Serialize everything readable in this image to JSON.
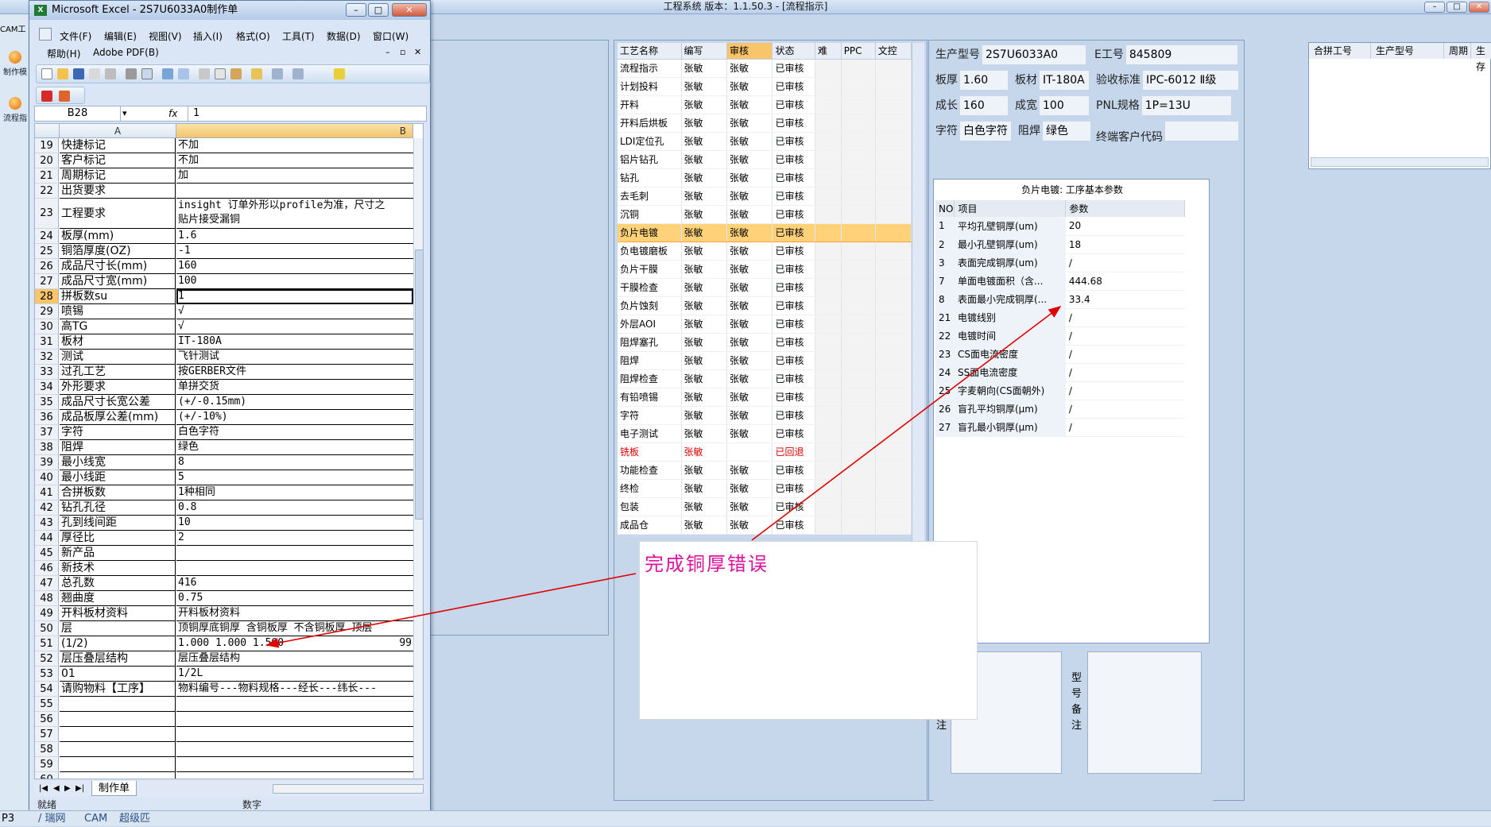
{
  "main_window": {
    "title": "工程系统  版本：1.1.50.3 - [流程指示]"
  },
  "left_sliver": {
    "top_text": "CAM工",
    "btn1": "制作模",
    "btn2": "流程指"
  },
  "process_table": {
    "headers": [
      "工艺名称",
      "编写",
      "审核",
      "状态",
      "难",
      "PPC",
      "文控"
    ],
    "rows": [
      {
        "name": "流程指示",
        "writer": "张敏",
        "reviewer": "张敏",
        "status": "已审核"
      },
      {
        "name": "计划投料",
        "writer": "张敏",
        "reviewer": "张敏",
        "status": "已审核"
      },
      {
        "name": "开料",
        "writer": "张敏",
        "reviewer": "张敏",
        "status": "已审核"
      },
      {
        "name": "开料后烘板",
        "writer": "张敏",
        "reviewer": "张敏",
        "status": "已审核"
      },
      {
        "name": "LDI定位孔",
        "writer": "张敏",
        "reviewer": "张敏",
        "status": "已审核"
      },
      {
        "name": "铝片钻孔",
        "writer": "张敏",
        "reviewer": "张敏",
        "status": "已审核"
      },
      {
        "name": "钻孔",
        "writer": "张敏",
        "reviewer": "张敏",
        "status": "已审核"
      },
      {
        "name": "去毛刺",
        "writer": "张敏",
        "reviewer": "张敏",
        "status": "已审核"
      },
      {
        "name": "沉铜",
        "writer": "张敏",
        "reviewer": "张敏",
        "status": "已审核"
      },
      {
        "name": "负片电镀",
        "writer": "张敏",
        "reviewer": "张敏",
        "status": "已审核"
      },
      {
        "name": "负电镀磨板",
        "writer": "张敏",
        "reviewer": "张敏",
        "status": "已审核"
      },
      {
        "name": "负片干膜",
        "writer": "张敏",
        "reviewer": "张敏",
        "status": "已审核"
      },
      {
        "name": "干膜检查",
        "writer": "张敏",
        "reviewer": "张敏",
        "status": "已审核"
      },
      {
        "name": "负片蚀刻",
        "writer": "张敏",
        "reviewer": "张敏",
        "status": "已审核"
      },
      {
        "name": "外层AOI",
        "writer": "张敏",
        "reviewer": "张敏",
        "status": "已审核"
      },
      {
        "name": "阻焊塞孔",
        "writer": "张敏",
        "reviewer": "张敏",
        "status": "已审核"
      },
      {
        "name": "阻焊",
        "writer": "张敏",
        "reviewer": "张敏",
        "status": "已审核"
      },
      {
        "name": "阻焊检查",
        "writer": "张敏",
        "reviewer": "张敏",
        "status": "已审核"
      },
      {
        "name": "有铅喷锡",
        "writer": "张敏",
        "reviewer": "张敏",
        "status": "已审核"
      },
      {
        "name": "字符",
        "writer": "张敏",
        "reviewer": "张敏",
        "status": "已审核"
      },
      {
        "name": "电子测试",
        "writer": "张敏",
        "reviewer": "张敏",
        "status": "已审核"
      },
      {
        "name": "铣板",
        "writer": "张敏",
        "reviewer": "",
        "status": "已回退"
      },
      {
        "name": "功能检查",
        "writer": "张敏",
        "reviewer": "张敏",
        "status": "已审核"
      },
      {
        "name": "终检",
        "writer": "张敏",
        "reviewer": "张敏",
        "status": "已审核"
      },
      {
        "name": "包装",
        "writer": "张敏",
        "reviewer": "张敏",
        "status": "已审核"
      },
      {
        "name": "成品仓",
        "writer": "张敏",
        "reviewer": "张敏",
        "status": "已审核"
      }
    ]
  },
  "info": {
    "prod_model_label": "生产型号",
    "prod_model": "2S7U6033A0",
    "e_no_label": "E工号",
    "e_no": "845809",
    "thickness_label": "板厚",
    "thickness": "1.60",
    "material_label": "板材",
    "material": "IT-180A",
    "standard_label": "验收标准",
    "standard": "IPC-6012 Ⅱ级",
    "length_label": "成长",
    "length": "160",
    "width_label": "成宽",
    "width": "100",
    "pnl_label": "PNL规格",
    "pnl": "1P=13U",
    "silk_label": "字符",
    "silk": "白色字符",
    "mask_label": "阻焊",
    "mask": "绿色",
    "end_cust_label": "终端客户代码",
    "end_cust": ""
  },
  "params": {
    "title": "负片电镀: 工序基本参数",
    "headers": [
      "NO",
      "项目",
      "参数"
    ],
    "rows": [
      {
        "no": "1",
        "name": "平均孔壁铜厚(um)",
        "value": "20"
      },
      {
        "no": "2",
        "name": "最小孔壁铜厚(um)",
        "value": "18"
      },
      {
        "no": "3",
        "name": "表面完成铜厚(um)",
        "value": "/"
      },
      {
        "no": "7",
        "name": "单面电镀面积（含...",
        "value": "444.68"
      },
      {
        "no": "8",
        "name": "表面最小完成铜厚(...",
        "value": "33.4"
      },
      {
        "no": "21",
        "name": "电镀线别",
        "value": "/"
      },
      {
        "no": "22",
        "name": "电镀时间",
        "value": "/"
      },
      {
        "no": "23",
        "name": "CS面电流密度",
        "value": "/"
      },
      {
        "no": "24",
        "name": "SS面电流密度",
        "value": "/"
      },
      {
        "no": "25",
        "name": "字麦朝向(CS面朝外)",
        "value": "/"
      },
      {
        "no": "26",
        "name": "盲孔平均铜厚(μm)",
        "value": "/"
      },
      {
        "no": "27",
        "name": "盲孔最小铜厚(μm)",
        "value": "/"
      }
    ]
  },
  "right_grid": {
    "headers": [
      "合拼工号",
      "生产型号",
      "周期",
      "生存"
    ]
  },
  "notes": {
    "left_label": "注",
    "right_label": "型号备注"
  },
  "excel": {
    "title": "Microsoft Excel - 2S7U6033A0制作单",
    "menu": [
      "文件(F)",
      "编辑(E)",
      "视图(V)",
      "插入(I)",
      "格式(O)",
      "工具(T)",
      "数据(D)",
      "窗口(W)",
      "帮助(H)",
      "Adobe PDF(B)"
    ],
    "name_box": "B28",
    "fx": "fx",
    "formula": "1",
    "col_a": "A",
    "col_b": "B",
    "rows": [
      {
        "n": "19",
        "a": "快捷标记",
        "b": "不加"
      },
      {
        "n": "20",
        "a": "客户标记",
        "b": "不加"
      },
      {
        "n": "21",
        "a": "周期标记",
        "b": "加"
      },
      {
        "n": "22",
        "a": "出货要求",
        "b": ""
      },
      {
        "n": "23",
        "a": "工程要求",
        "b": "insight 订单外形以profile为准，尺寸之",
        "b2": "贴片接受漏铜"
      },
      {
        "n": "24",
        "a": "板厚(mm)",
        "b": "1.6"
      },
      {
        "n": "25",
        "a": "铜箔厚度(OZ)",
        "b": "-1"
      },
      {
        "n": "26",
        "a": "成品尺寸长(mm)",
        "b": "160"
      },
      {
        "n": "27",
        "a": "成品尺寸宽(mm)",
        "b": "100"
      },
      {
        "n": "28",
        "a": "拼板数su",
        "b": "1"
      },
      {
        "n": "29",
        "a": "喷锡",
        "b": "√"
      },
      {
        "n": "30",
        "a": "高TG",
        "b": "√"
      },
      {
        "n": "31",
        "a": "板材",
        "b": "IT-180A"
      },
      {
        "n": "32",
        "a": "测试",
        "b": "飞针测试"
      },
      {
        "n": "33",
        "a": "过孔工艺",
        "b": "按GERBER文件"
      },
      {
        "n": "34",
        "a": "外形要求",
        "b": "单拼交货"
      },
      {
        "n": "35",
        "a": "成品尺寸长宽公差",
        "b": "(+/-0.15mm)"
      },
      {
        "n": "36",
        "a": "成品板厚公差(mm)",
        "b": "(+/-10%)"
      },
      {
        "n": "37",
        "a": "字符",
        "b": "白色字符"
      },
      {
        "n": "38",
        "a": "阻焊",
        "b": "绿色"
      },
      {
        "n": "39",
        "a": "最小线宽",
        "b": "8"
      },
      {
        "n": "40",
        "a": "最小线距",
        "b": "5"
      },
      {
        "n": "41",
        "a": "合拼板数",
        "b": "1种相同"
      },
      {
        "n": "42",
        "a": "钻孔孔径",
        "b": "0.8"
      },
      {
        "n": "43",
        "a": "孔到线间距",
        "b": "10"
      },
      {
        "n": "44",
        "a": "厚径比",
        "b": "2"
      },
      {
        "n": "45",
        "a": "新产品",
        "b": ""
      },
      {
        "n": "46",
        "a": "新技术",
        "b": ""
      },
      {
        "n": "47",
        "a": "总孔数",
        "b": "416"
      },
      {
        "n": "48",
        "a": "翘曲度",
        "b": "0.75"
      },
      {
        "n": "49",
        "a": "开料板材资料",
        "b": "开料板材资料"
      },
      {
        "n": "50",
        "a": "层",
        "b": "顶铜厚底铜厚 含铜板厚 不含铜板厚 顶层"
      },
      {
        "n": "51",
        "a": "(1/2)",
        "b": "1.000  1.000  1.500",
        "b_end": "99"
      },
      {
        "n": "52",
        "a": "层压叠层结构",
        "b": "层压叠层结构"
      },
      {
        "n": "53",
        "a": "01",
        "b": "1/2L"
      },
      {
        "n": "54",
        "a": "请购物料【工序】",
        "b": "物料编号---物料规格---经长---纬长---"
      },
      {
        "n": "55",
        "a": "",
        "b": ""
      },
      {
        "n": "56",
        "a": "",
        "b": ""
      },
      {
        "n": "57",
        "a": "",
        "b": ""
      },
      {
        "n": "58",
        "a": "",
        "b": ""
      },
      {
        "n": "59",
        "a": "",
        "b": ""
      },
      {
        "n": "60",
        "a": "",
        "b": ""
      }
    ],
    "sheet_tab": "制作单",
    "status_left": "就绪",
    "status_mid": "数字"
  },
  "callout": {
    "text": "完成铜厚错误"
  },
  "bottom_bar": {
    "items": [
      "P3",
      "/ 瑞网",
      "CAM",
      "超级匹"
    ]
  },
  "colors": {
    "accent": "#f9c46a",
    "selected_row": "#ffd27a",
    "annotation_pink": "#e0119a",
    "annotation_red": "#e00000"
  }
}
